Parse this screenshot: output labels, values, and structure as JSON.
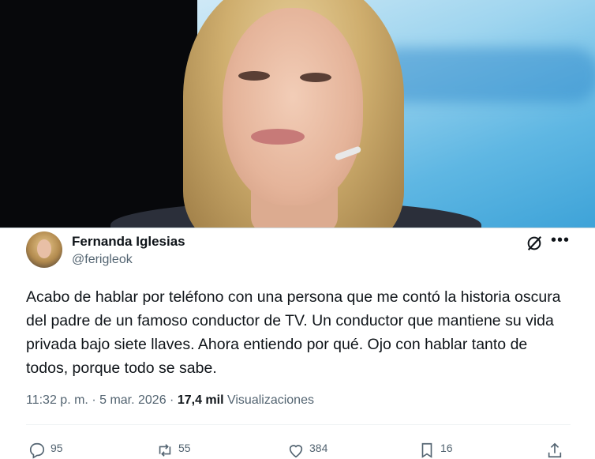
{
  "tweet": {
    "author_name": "Fernanda Iglesias",
    "author_handle": "@ferigleok",
    "text": "Acabo de hablar por teléfono con una persona que me contó la historia oscura del padre de un famoso conductor de TV. Un conductor que mantiene su vida privada bajo siete llaves. Ahora entiendo por qué. Ojo con hablar tanto de todos, porque todo se sabe.",
    "time": "11:32 p. m.",
    "separator": "·",
    "date": "5 mar. 2026",
    "views_count": "17,4 mil",
    "views_label": "Visualizaciones"
  },
  "actions": {
    "replies": "95",
    "reposts": "55",
    "likes": "384",
    "bookmarks": "16"
  },
  "icons": {
    "more": "more-horizontal-icon",
    "grok": "grok-icon",
    "reply": "reply-icon",
    "repost": "repost-icon",
    "like": "heart-icon",
    "bookmark": "bookmark-icon",
    "share": "share-icon"
  },
  "colors": {
    "text_primary": "#0f1419",
    "text_secondary": "#536471",
    "border": "#cfd9de"
  }
}
